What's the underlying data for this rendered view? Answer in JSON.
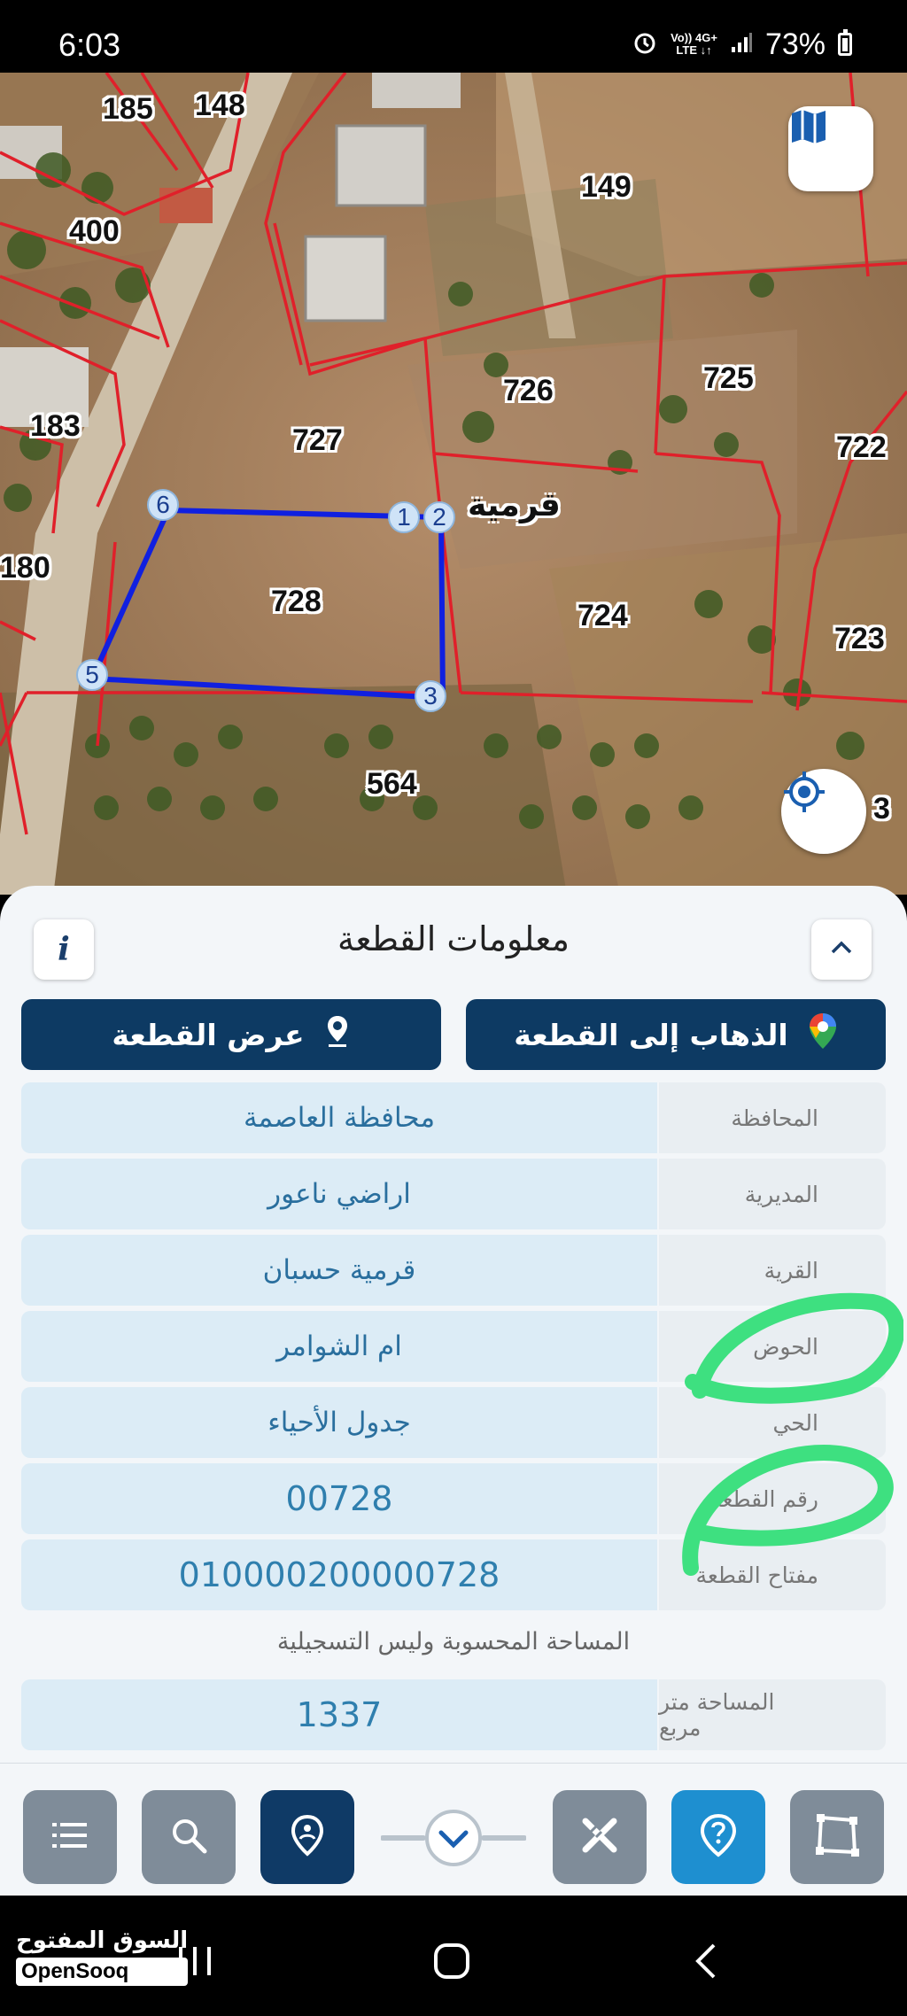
{
  "status_bar": {
    "time": "6:03",
    "network_top": "Vo)) 4G+",
    "network_bottom": "LTE ↓↑",
    "battery": "73%"
  },
  "map": {
    "parcel_numbers": [
      "185",
      "148",
      "149",
      "400",
      "726",
      "725",
      "183",
      "727",
      "722",
      "180",
      "728",
      "724",
      "723",
      "564",
      "3"
    ],
    "village_label": "قرمية",
    "vertices": [
      "6",
      "1",
      "2",
      "3",
      "5"
    ],
    "outline_color": "#1020e0",
    "boundary_color": "#e0202a"
  },
  "panel": {
    "title": "معلومات القطعة",
    "info_label": "i",
    "go_button": "الذهاب إلى القطعة",
    "show_button": "عرض القطعة",
    "rows": [
      {
        "label": "المحافظة",
        "value": "محافظة العاصمة"
      },
      {
        "label": "المديرية",
        "value": "اراضي ناعور"
      },
      {
        "label": "القرية",
        "value": "قرمية حسبان"
      },
      {
        "label": "الحوض",
        "value": "ام الشوامر"
      },
      {
        "label": "الحي",
        "value": "جدول الأحياء"
      },
      {
        "label": "رقم القطعة",
        "value": "00728"
      },
      {
        "label": "مفتاح القطعة",
        "value": "010000200000728"
      }
    ],
    "note": "المساحة المحسوبة وليس التسجيلية",
    "area": {
      "label": "المساحة متر مربع",
      "value": "1337"
    }
  },
  "toolbar": {
    "icons": [
      "layers-list-icon",
      "search-icon",
      "parcel-location-icon",
      "chevron-down-icon",
      "measure-tools-icon",
      "help-icon",
      "polygon-icon"
    ]
  },
  "watermark": {
    "arabic": "السوق المفتوح",
    "english": "OpenSooq"
  },
  "colors": {
    "primary": "#0d3a63",
    "accent_blue": "#1e8fd0",
    "value_bg": "#dcecf6",
    "highlight_green": "#3ee080"
  }
}
